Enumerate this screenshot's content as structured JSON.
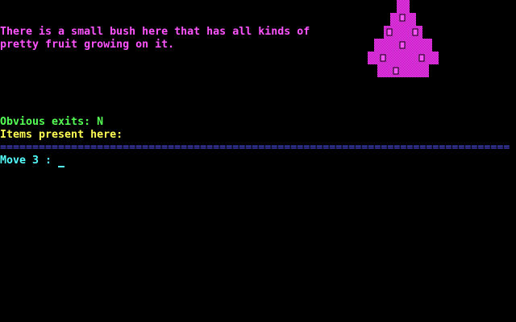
{
  "room": {
    "description_lines": [
      "There is a small bush here that has all kinds of",
      "pretty fruit growing on it."
    ],
    "exits_label": "Obvious exits: N",
    "items_label": "Items present here:"
  },
  "divider": "===============================================================================",
  "prompt": {
    "text": "Move 3 :"
  },
  "palette": {
    "background": "#000000",
    "description": "#ff55ff",
    "exits": "#55ff55",
    "items": "#ffff55",
    "divider": "#5555ff",
    "prompt": "#55ffff",
    "bush_dark": "#aa00aa",
    "bush_light": "#ff55ff"
  },
  "graphic": {
    "name": "fruit-bush"
  }
}
